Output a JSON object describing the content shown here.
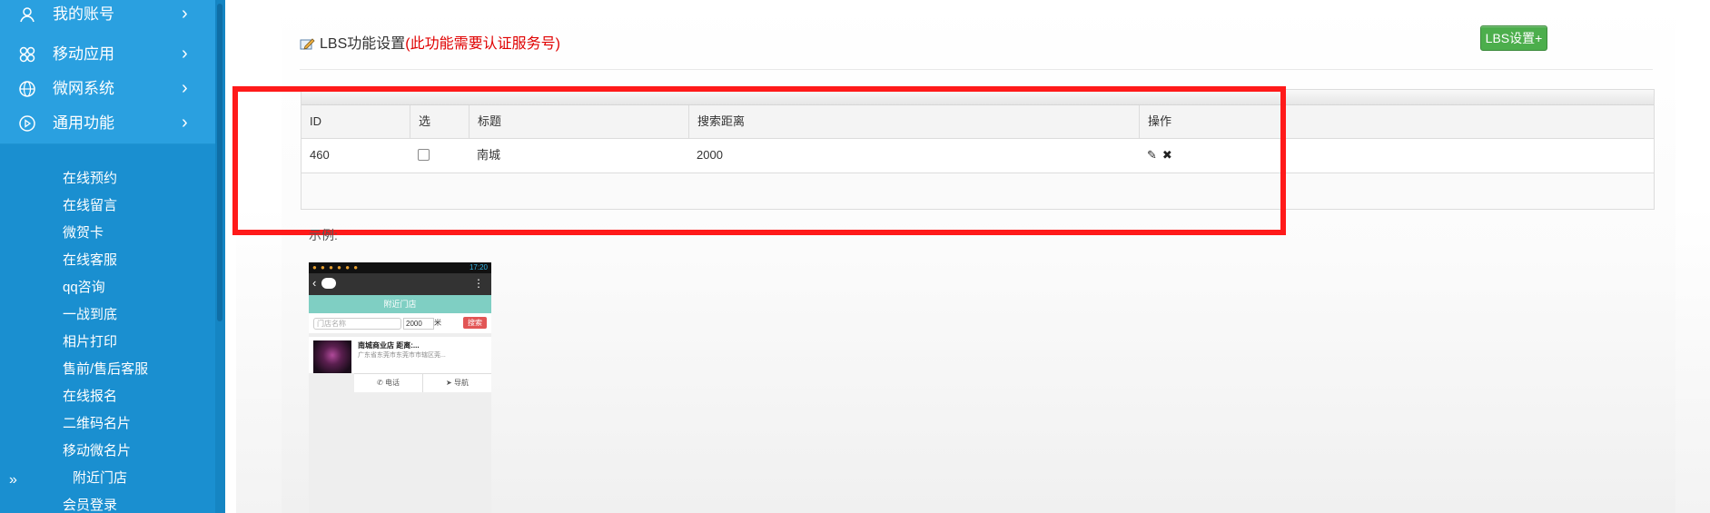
{
  "sidebar": {
    "menu": [
      {
        "label": "我的账号",
        "icon": "user-icon",
        "arrow": "›"
      },
      {
        "label": "移动应用",
        "icon": "apps-icon",
        "arrow": "›"
      },
      {
        "label": "微网系统",
        "icon": "globe-icon",
        "arrow": "›"
      },
      {
        "label": "通用功能",
        "icon": "play-circle-icon",
        "arrow": "›"
      }
    ],
    "submenu": [
      "在线预约",
      "在线留言",
      "微贺卡",
      "在线客服",
      "qq咨询",
      "一战到底",
      "相片打印",
      "售前/售后客服",
      "在线报名",
      "二维码名片",
      "移动微名片",
      "附近门店",
      "会员登录"
    ],
    "expand_glyph": "»"
  },
  "header": {
    "title": "LBS功能设置",
    "note": "(此功能需要认证服务号)",
    "button_label": "LBS设置+"
  },
  "table": {
    "columns": [
      "ID",
      "选",
      "标题",
      "搜索距离",
      "操作"
    ],
    "rows": [
      {
        "id": "460",
        "checked": false,
        "title": "南城",
        "distance": "2000"
      }
    ],
    "edit_glyph": "✎",
    "delete_glyph": "✖"
  },
  "example": {
    "label": "示例:"
  },
  "phone": {
    "time": "17:20",
    "title": "附近门店",
    "search_placeholder": "门店名称",
    "distance_value": "2000",
    "unit": "米",
    "search_button": "搜索",
    "store_name": "南城商业店 距离:...",
    "store_address": "广东省东莞市东莞市市辖区莞...",
    "call_label": "电话",
    "nav_label": "导航"
  },
  "colors": {
    "sidebar_bg": "#1a8fd0",
    "menu_bg": "#2aa0e0",
    "highlight": "#ff1a1a",
    "note_red": "#e00000",
    "button_green": "#4cae4c"
  }
}
